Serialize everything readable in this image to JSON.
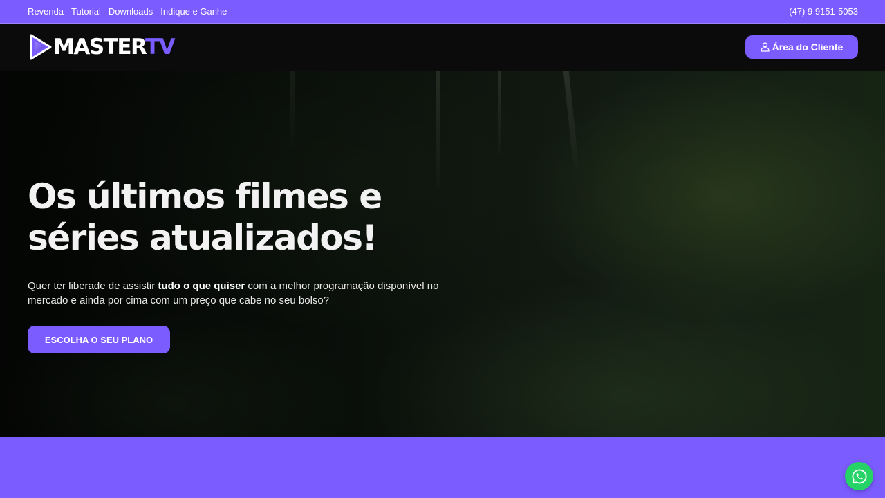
{
  "topbar": {
    "nav": [
      "Revenda",
      "Tutorial",
      "Downloads",
      "Indique e Ganhe"
    ],
    "phone": "(47) 9 9151-5053",
    "bg_color": "#7a5cff"
  },
  "header": {
    "logo": {
      "master": "MASTER",
      "tv": "TV",
      "icon": "play-icon"
    },
    "client_button": {
      "label": "Área do Cliente",
      "icon": "user-icon"
    }
  },
  "hero": {
    "title_line1": "Os últimos filmes e",
    "title_line2": "séries atualizados!",
    "text_part1": "Quer ter liberade de assistir ",
    "text_bold": "tudo o que quiser",
    "text_part2": " com a melhor programação disponível no mercado e ainda por cima com um preço que cabe no seu bolso?",
    "cta": "ESCOLHA O SEU PLANO",
    "background": "forest-photo"
  },
  "floating": {
    "whatsapp_icon": "whatsapp-icon",
    "color": "#25d366"
  },
  "colors": {
    "accent": "#7a5cff",
    "header_bg": "#0b0b0c"
  }
}
